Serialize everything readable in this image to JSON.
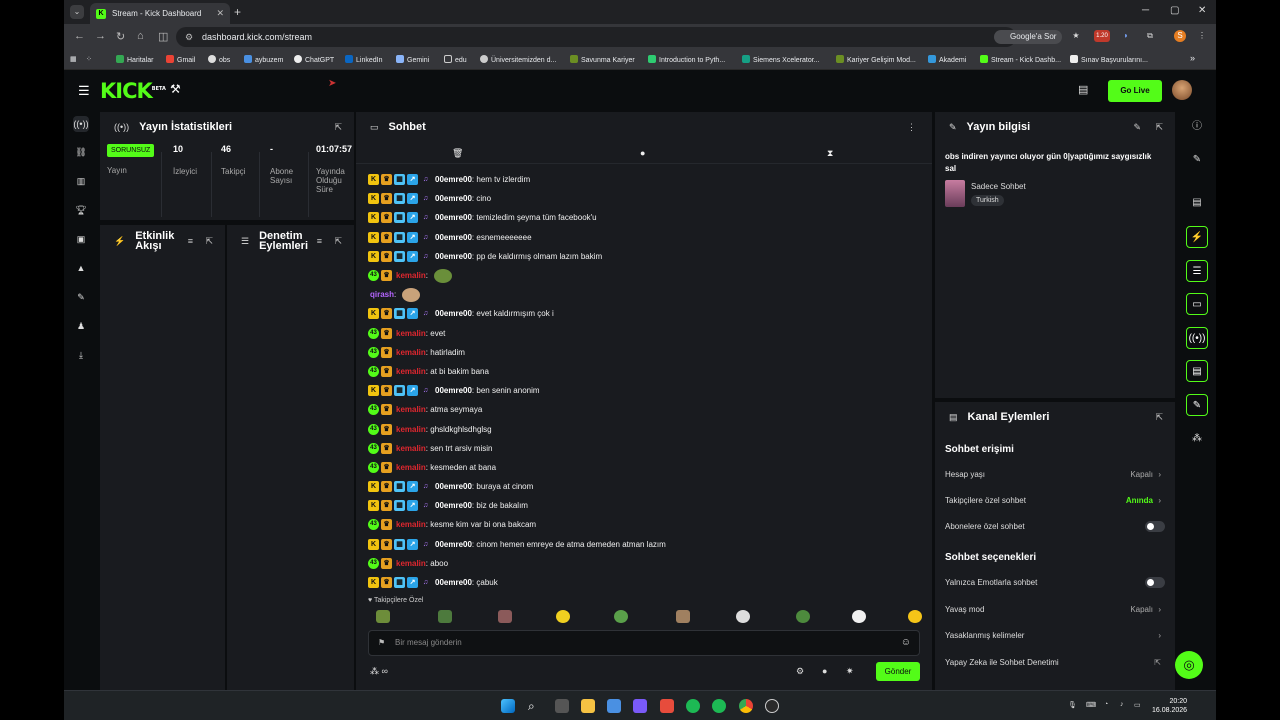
{
  "browser": {
    "tab_title": "Stream - Kick Dashboard",
    "url": "dashboard.kick.com/stream",
    "google_button": "Google'a Sor",
    "ext_badge": "1.20",
    "bookmarks": [
      "Haritalar",
      "Gmail",
      "obs",
      "aybuzem",
      "ChatGPT",
      "LinkedIn",
      "Gemini",
      "edu",
      "Üniversitemizden d...",
      "Savunma Kariyer",
      "Introduction to Pyth...",
      "Siemens Xcelerator...",
      "Kariyer Gelişim Mod...",
      "Akademi",
      "Stream - Kick Dashb...",
      "Sınav Başvurularını..."
    ]
  },
  "app": {
    "logo": "KICK",
    "logo_sup": "BETA",
    "go_live": "Go Live"
  },
  "stats": {
    "title": "Yayın İstatistikleri",
    "status_badge": "SORUNSUZ",
    "status_label": "Yayın",
    "viewers": "10",
    "viewers_label": "İzleyici",
    "followers": "46",
    "followers_label": "Takipçi",
    "subs": "-",
    "subs_label": "Abone Sayısı",
    "duration": "01:07:57",
    "duration_label": "Yayında Olduğu Süre"
  },
  "activity": {
    "title": "Etkinlik Akışı"
  },
  "moderation": {
    "title": "Denetim Eylemleri"
  },
  "chat": {
    "title": "Sohbet",
    "followers_only": "Takipçilere Özel",
    "placeholder": "Bir mesaj gönderin",
    "send": "Gönder",
    "messages": [
      {
        "user": "00emre00",
        "type": "omre",
        "text": "hem tv izlerdim"
      },
      {
        "user": "00emre00",
        "type": "omre",
        "text": "cino"
      },
      {
        "user": "00emre00",
        "type": "omre",
        "text": "temizledim şeyma tüm facebook'u"
      },
      {
        "user": "00emre00",
        "type": "omre",
        "text": "esnemeeeeeee"
      },
      {
        "user": "00emre00",
        "type": "omre",
        "text": "pp de kaldırmış olmam lazım bakim"
      },
      {
        "user": "kemalin",
        "type": "kemal",
        "text": "",
        "emote": "#6a8f3a"
      },
      {
        "user": "qirash",
        "type": "qirash",
        "text": "",
        "emote": "#c9a27a"
      },
      {
        "user": "00emre00",
        "type": "omre",
        "text": "evet kaldırmışım çok i"
      },
      {
        "user": "kemalin",
        "type": "kemal",
        "text": "evet"
      },
      {
        "user": "kemalin",
        "type": "kemal",
        "text": "hatirladim"
      },
      {
        "user": "kemalin",
        "type": "kemal",
        "text": "at bi bakim bana"
      },
      {
        "user": "00emre00",
        "type": "omre",
        "text": "ben senin anonim"
      },
      {
        "user": "kemalin",
        "type": "kemal",
        "text": "atma seymaya"
      },
      {
        "user": "kemalin",
        "type": "kemal",
        "text": "ghsldkghlsdhglsg"
      },
      {
        "user": "kemalin",
        "type": "kemal",
        "text": "sen trt arsiv misin"
      },
      {
        "user": "kemalin",
        "type": "kemal",
        "text": "kesmeden at bana"
      },
      {
        "user": "00emre00",
        "type": "omre",
        "text": "buraya at cinom"
      },
      {
        "user": "00emre00",
        "type": "omre",
        "text": "biz de bakalım"
      },
      {
        "user": "kemalin",
        "type": "kemal",
        "text": "kesme kim var bi ona bakcam"
      },
      {
        "user": "00emre00",
        "type": "omre",
        "text": "cinom hemen emreye de atma demeden atman lazım"
      },
      {
        "user": "kemalin",
        "type": "kemal",
        "text": "aboo"
      },
      {
        "user": "00emre00",
        "type": "omre",
        "text": "çabuk"
      }
    ]
  },
  "stream_info": {
    "title": "Yayın bilgisi",
    "stream_title": "obs indiren yayıncı oluyor gün 0|yaptığımız saygısızlık sal",
    "category": "Sadece Sohbet",
    "language": "Turkish"
  },
  "channel_actions": {
    "title": "Kanal Eylemleri",
    "chat_access": "Sohbet erişimi",
    "account_age": "Hesap yaşı",
    "account_age_value": "Kapalı",
    "followers_chat": "Takipçilere özel sohbet",
    "followers_chat_value": "Anında",
    "subs_chat": "Abonelere özel sohbet",
    "chat_options": "Sohbet seçenekleri",
    "emote_only": "Yalnızca Emotlarla sohbet",
    "slow_mode": "Yavaş mod",
    "slow_mode_value": "Kapalı",
    "banned_words": "Yasaklanmış kelimeler",
    "ai_moderation": "Yapay Zeka ile Sohbet Denetimi"
  },
  "taskbar": {
    "time": "20:20",
    "date": "16.08.2026"
  }
}
